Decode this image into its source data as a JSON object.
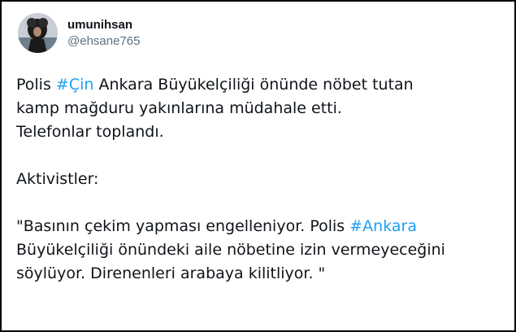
{
  "user": {
    "display_name": "umunihsan",
    "handle": "@ehsane765"
  },
  "tweet": {
    "line1": {
      "before": "Polis ",
      "hashtag": "#Çin",
      "after": " Ankara Büyükelçiliği önünde nöbet tutan"
    },
    "line2": "kamp mağduru yakınlarına müdahale etti.",
    "line3": "Telefonlar toplandı.",
    "line4": "Aktivistler:",
    "line5": {
      "before": "\"Basının çekim yapması engelleniyor. Polis ",
      "hashtag": "#Ankara"
    },
    "line6": "Büyükelçiliği önündeki aile nöbetine izin vermeyeceğini",
    "line7": "söylüyor. Direnenleri arabaya kilitliyor. \""
  },
  "colors": {
    "text": "#0f1419",
    "secondary": "#5b7083",
    "hashtag": "#1da1f2",
    "border": "#000000"
  }
}
